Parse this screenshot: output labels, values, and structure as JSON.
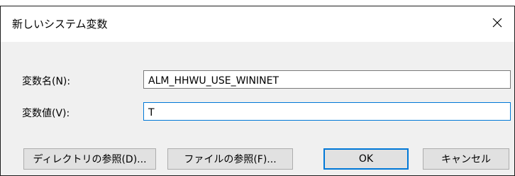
{
  "dialog": {
    "title": "新しいシステム変数",
    "close_icon": "close-icon"
  },
  "fields": {
    "name_label": "変数名(N):",
    "name_value": "ALM_HHWU_USE_WININET",
    "value_label": "変数値(V):",
    "value_value": "T"
  },
  "buttons": {
    "browse_directory": "ディレクトリの参照(D)...",
    "browse_file": "ファイルの参照(F)...",
    "ok": "OK",
    "cancel": "キャンセル"
  },
  "colors": {
    "focus_accent": "#0078d7",
    "content_bg": "#f0f0f0",
    "button_bg": "#e1e1e1"
  }
}
